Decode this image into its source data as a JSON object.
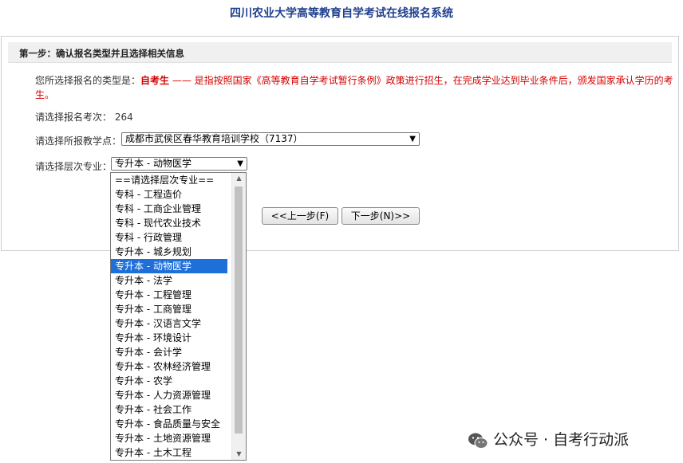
{
  "page": {
    "title": "四川农业大学高等教育自学考试在线报名系统"
  },
  "step": {
    "label": "第一步：确认报名类型并且选择相关信息"
  },
  "registration_type": {
    "label": "您所选择报名的类型是：",
    "type_name": "自考生",
    "description": " —— 是指按照国家《高等教育自学考试暂行条例》政策进行招生，在完成学业达到毕业条件后，颁发国家承认学历的考生。"
  },
  "exam_session": {
    "label": "请选择报名考次：",
    "value": "264"
  },
  "teaching_point": {
    "label": "请选择所报教学点：",
    "selected": "成都市武侯区春华教育培训学校（7137）"
  },
  "major": {
    "label": "请选择层次专业：",
    "selected": "专升本 - 动物医学",
    "options": [
      "==请选择层次专业==",
      "专科 - 工程造价",
      "专科 - 工商企业管理",
      "专科 - 现代农业技术",
      "专科 - 行政管理",
      "专升本 - 城乡规划",
      "专升本 - 动物医学",
      "专升本 - 法学",
      "专升本 - 工程管理",
      "专升本 - 工商管理",
      "专升本 - 汉语言文学",
      "专升本 - 环境设计",
      "专升本 - 会计学",
      "专升本 - 农林经济管理",
      "专升本 - 农学",
      "专升本 - 人力资源管理",
      "专升本 - 社会工作",
      "专升本 - 食品质量与安全",
      "专升本 - 土地资源管理",
      "专升本 - 土木工程"
    ],
    "selected_index": 6
  },
  "buttons": {
    "prev": "<<上一步(F)",
    "next": "下一步(N)>>"
  },
  "watermark": {
    "text": "公众号 · 自考行动派",
    "icon": "wechat-icon"
  },
  "colors": {
    "title": "#1f3f8f",
    "highlight_red": "#d40000",
    "selection": "#1e6fd9"
  }
}
